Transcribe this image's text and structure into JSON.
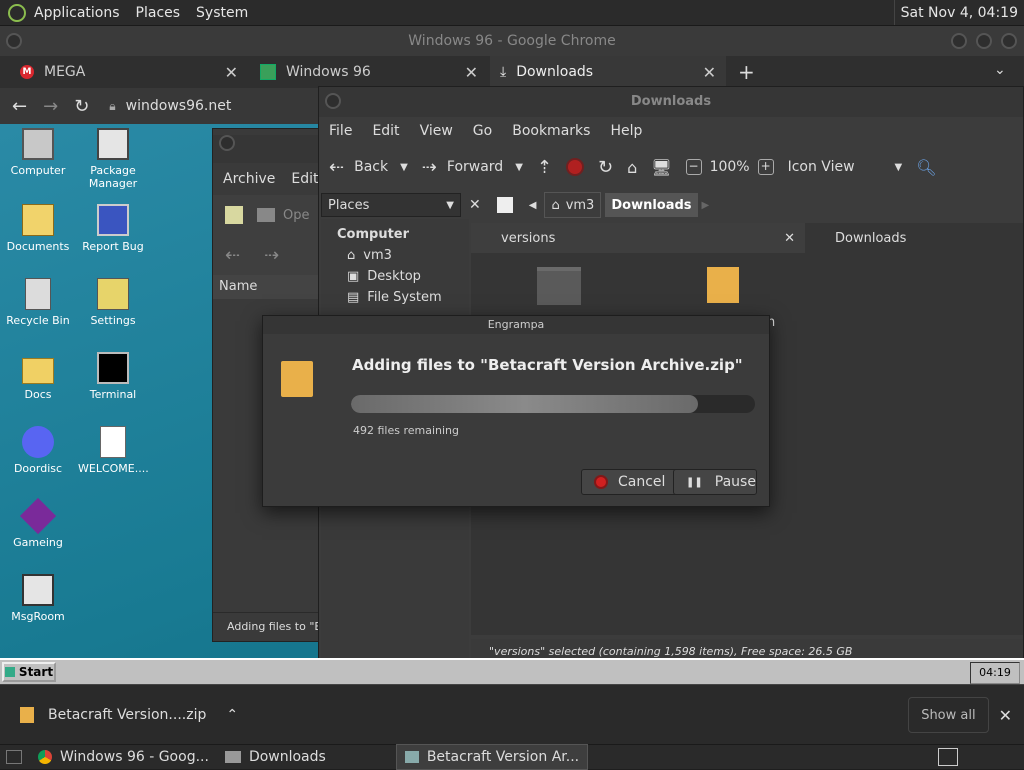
{
  "top_panel": {
    "menus": [
      "Applications",
      "Places",
      "System"
    ],
    "clock": "Sat Nov 4, 04:19"
  },
  "chrome": {
    "title": "Windows 96 - Google Chrome",
    "tabs": [
      {
        "label": "MEGA",
        "icon": "mega-icon"
      },
      {
        "label": "Windows 96",
        "icon": "windows96-icon"
      },
      {
        "label": "Downloads",
        "icon": "download-icon"
      }
    ],
    "address": "windows96.net"
  },
  "desktop_icons": [
    {
      "label": "Computer",
      "icon": "computer-icon"
    },
    {
      "label": "Package Manager",
      "icon": "package-manager-icon"
    },
    {
      "label": "Documents",
      "icon": "documents-icon"
    },
    {
      "label": "Report Bug",
      "icon": "report-bug-icon"
    },
    {
      "label": "Recycle Bin",
      "icon": "recycle-bin-icon"
    },
    {
      "label": "Settings",
      "icon": "settings-icon"
    },
    {
      "label": "Docs",
      "icon": "folder-icon"
    },
    {
      "label": "Terminal",
      "icon": "terminal-icon"
    },
    {
      "label": "Doordisc",
      "icon": "doordisc-icon"
    },
    {
      "label": "WELCOME....",
      "icon": "markdown-file-icon"
    },
    {
      "label": "Gameing",
      "icon": "cube-icon"
    },
    {
      "label": "MsgRoom",
      "icon": "msgroom-icon"
    }
  ],
  "w96_taskbar": {
    "start": "Start",
    "clock": "04:19"
  },
  "engrampa_main": {
    "menus": [
      "Archive",
      "Edit"
    ],
    "toolbar_open": "Ope",
    "column_name": "Name",
    "status": "Adding files to \"Bet"
  },
  "caja": {
    "title": "Downloads",
    "menus": [
      "File",
      "Edit",
      "View",
      "Go",
      "Bookmarks",
      "Help"
    ],
    "toolbar": {
      "back": "Back",
      "forward": "Forward",
      "zoom": "100%",
      "view": "Icon View"
    },
    "sidebar_header": "Places",
    "breadcrumbs": [
      "vm3",
      "Downloads"
    ],
    "places_section": "Computer",
    "places": [
      "vm3",
      "Desktop",
      "File System"
    ],
    "tabs": [
      "versions",
      "Downloads"
    ],
    "partial_label": "on",
    "status": "\"versions\" selected (containing 1,598 items), Free space: 26.5 GB"
  },
  "dialog": {
    "window_title": "Engrampa",
    "heading": "Adding files to \"Betacraft Version Archive.zip\"",
    "progress": 0.86,
    "remaining": "492 files remaining",
    "cancel": "Cancel",
    "pause": "Pause"
  },
  "download_bar": {
    "file": "Betacraft Version....zip",
    "show_all": "Show all"
  },
  "bottom_taskbar": {
    "tasks": [
      "Windows 96 - Goog...",
      "Downloads",
      "Betacraft Version Ar..."
    ]
  }
}
